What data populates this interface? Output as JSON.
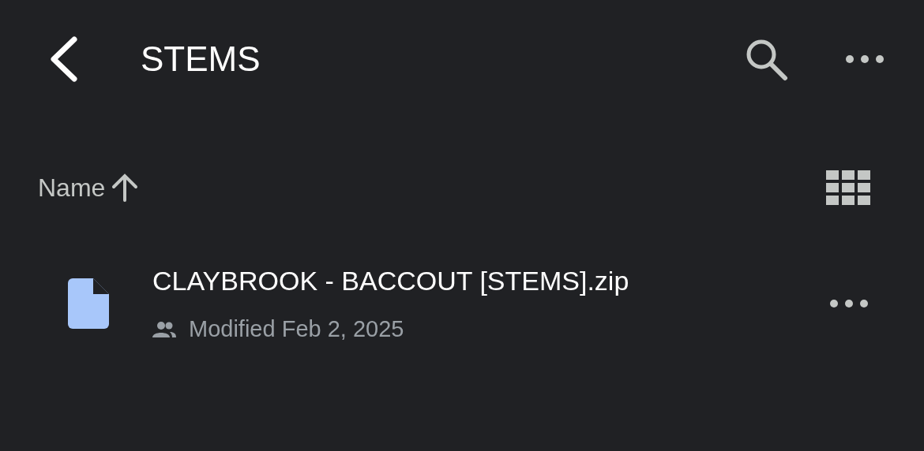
{
  "header": {
    "title": "STEMS"
  },
  "sort": {
    "label": "Name",
    "ascending": true
  },
  "files": [
    {
      "name": "CLAYBROOK - BACCOUT [STEMS].zip",
      "shared": true,
      "modified": "Modified Feb 2, 2025"
    }
  ]
}
